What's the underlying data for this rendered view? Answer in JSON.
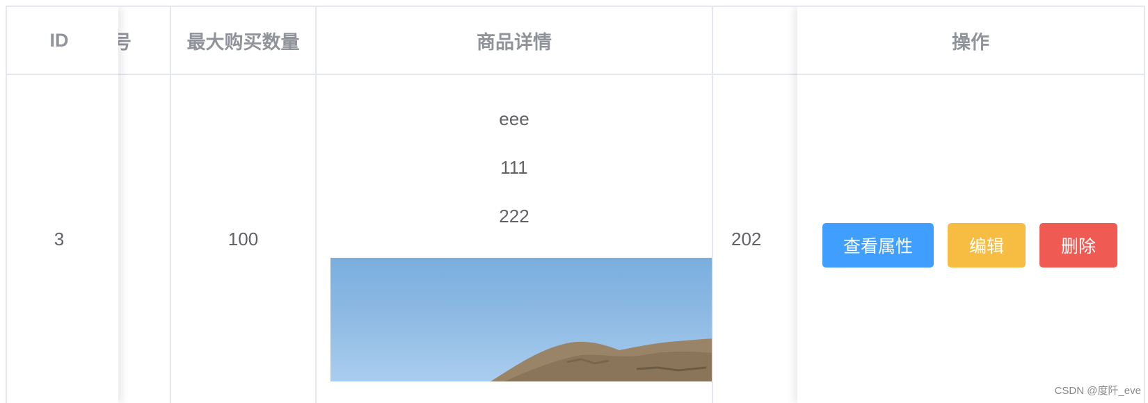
{
  "table": {
    "headers": {
      "id": "ID",
      "code_partial": "号",
      "max_qty": "最大购买数量",
      "details": "商品详情",
      "actions": "操作"
    },
    "row": {
      "id": "3",
      "max_qty": "100",
      "details_lines": [
        "eee",
        "111",
        "222"
      ],
      "date_partial": "202"
    },
    "actions": {
      "view_attrs": "查看属性",
      "edit": "编辑",
      "delete": "删除"
    }
  },
  "colors": {
    "primary": "#409eff",
    "warning": "#f7bd42",
    "danger": "#ef5a52",
    "border": "#e4e7ed",
    "header_text": "#909399",
    "cell_text": "#606266"
  },
  "watermark": "CSDN @度阡_eve"
}
